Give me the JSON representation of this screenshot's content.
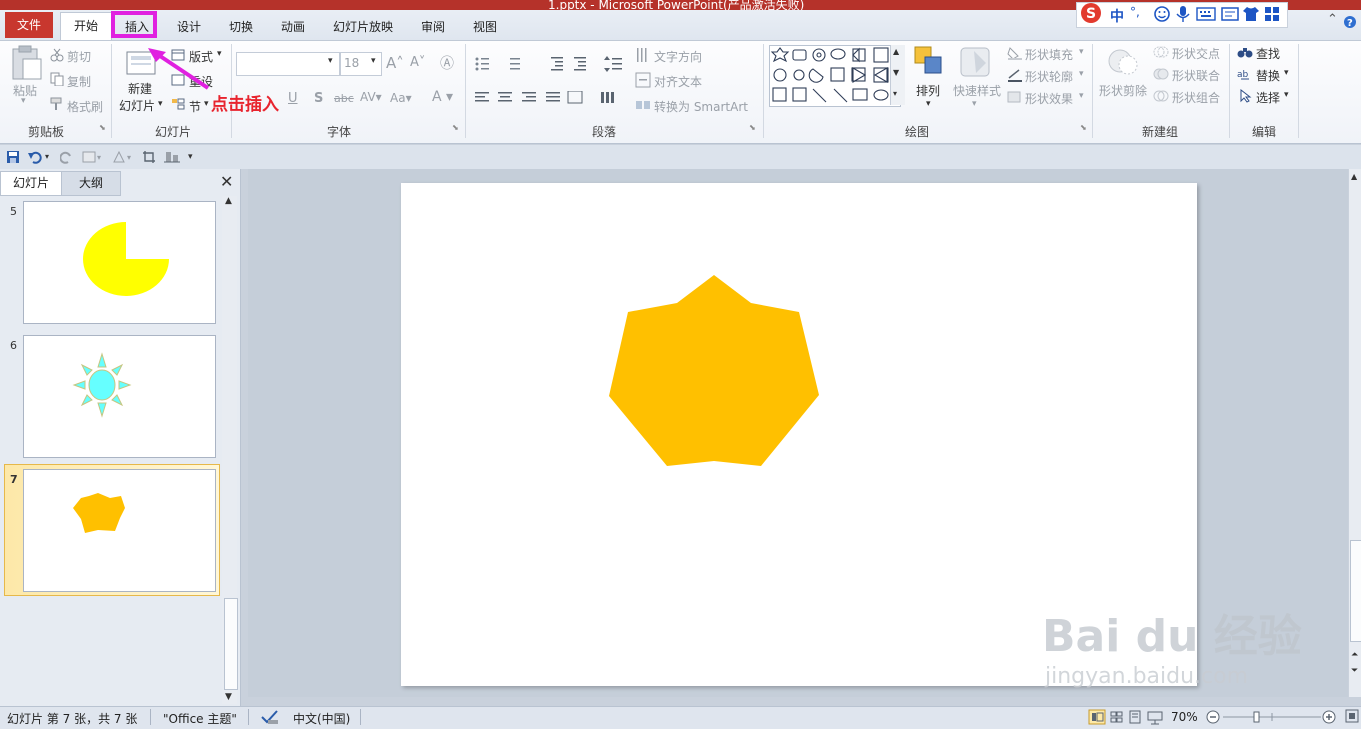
{
  "window": {
    "title": "1.pptx - Microsoft PowerPoint(产品激活失败)"
  },
  "tabs": {
    "file": "文件",
    "home": "开始",
    "insert": "插入",
    "design": "设计",
    "transitions": "切换",
    "animations": "动画",
    "slideshow": "幻灯片放映",
    "review": "审阅",
    "view": "视图"
  },
  "ime": {
    "lang": "中",
    "punct": "°,"
  },
  "ribbon": {
    "clipboard": {
      "paste": "粘贴",
      "cut": "剪切",
      "copy": "复制",
      "format_painter": "格式刷",
      "label": "剪贴板"
    },
    "slides": {
      "new_slide_line1": "新建",
      "new_slide_line2": "幻灯片",
      "layout": "版式",
      "reset": "重设",
      "section": "节",
      "label": "幻灯片"
    },
    "font": {
      "size": "18",
      "label": "字体"
    },
    "paragraph": {
      "text_direction": "文字方向",
      "align_text": "对齐文本",
      "convert_smartart": "转换为 SmartArt",
      "label": "段落"
    },
    "drawing": {
      "arrange": "排列",
      "quick_styles": "快速样式",
      "shape_fill": "形状填充",
      "shape_outline": "形状轮廓",
      "shape_effects": "形状效果",
      "label": "绘图"
    },
    "new_group": {
      "shape_subtract": "形状剪除",
      "shape_intersect": "形状交点",
      "shape_union": "形状联合",
      "shape_combine": "形状组合",
      "label": "新建组"
    },
    "editing": {
      "find": "查找",
      "replace": "替换",
      "select": "选择",
      "label": "编辑"
    }
  },
  "annotation": "点击插入",
  "left_pane": {
    "tab_slides": "幻灯片",
    "tab_outline": "大纲",
    "thumbnails": [
      {
        "number": "5",
        "shape": "yellow-pie"
      },
      {
        "number": "6",
        "shape": "cyan-sun"
      },
      {
        "number": "7",
        "shape": "orange-seven-point-star",
        "selected": true
      }
    ]
  },
  "colors": {
    "accent_red": "#c8372e",
    "highlight_magenta": "#e021e0",
    "star_fill": "#ffc000",
    "pie_fill": "#ffff00",
    "sun_fill": "#66ffff"
  },
  "status": {
    "slide_info": "幻灯片 第 7 张，共 7 张",
    "theme": "\"Office 主题\"",
    "language": "中文(中国)",
    "zoom": "70%"
  },
  "watermark": {
    "brand": "Bai du 经验",
    "url": "jingyan.baidu.com"
  }
}
